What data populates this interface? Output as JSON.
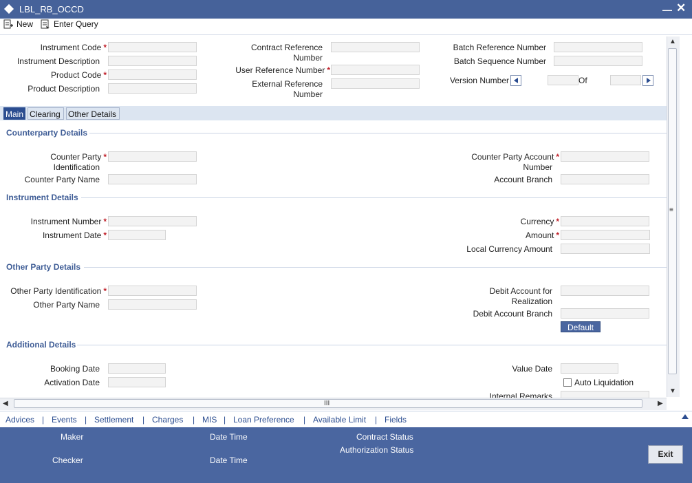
{
  "window": {
    "title": "LBL_RB_OCCD"
  },
  "toolbar": {
    "new_label": "New",
    "enter_query_label": "Enter Query"
  },
  "header": {
    "instrument_code": "Instrument Code",
    "instrument_description": "Instrument Description",
    "product_code": "Product Code",
    "product_description": "Product Description",
    "contract_reference_1": "Contract Reference",
    "contract_reference_2": "Number",
    "user_reference_number": "User Reference Number",
    "external_reference_1": "External Reference",
    "external_reference_2": "Number",
    "batch_reference_number": "Batch Reference Number",
    "batch_sequence_number": "Batch Sequence Number",
    "version_number": "Version Number",
    "of": "Of"
  },
  "required_marker": "*",
  "tabs": {
    "main": "Main",
    "clearing": "Clearing",
    "other_details": "Other Details"
  },
  "sections": {
    "counterparty": "Counterparty Details",
    "instrument": "Instrument Details",
    "other_party": "Other Party Details",
    "additional": "Additional Details"
  },
  "counterparty": {
    "identification_1": "Counter Party",
    "identification_2": "Identification",
    "name": "Counter Party Name",
    "account_1": "Counter Party Account",
    "account_2": "Number",
    "account_branch": "Account Branch"
  },
  "instrument": {
    "number": "Instrument Number",
    "date": "Instrument Date",
    "currency": "Currency",
    "amount": "Amount",
    "local_currency_amount": "Local Currency Amount"
  },
  "other_party": {
    "identification": "Other Party Identification",
    "name": "Other Party Name",
    "debit_account_1": "Debit Account for",
    "debit_account_2": "Realization",
    "debit_account_branch": "Debit Account Branch",
    "default_button": "Default"
  },
  "additional": {
    "booking_date": "Booking Date",
    "activation_date": "Activation Date",
    "value_date": "Value Date",
    "auto_liquidation": "Auto Liquidation",
    "internal_remarks": "Internal Remarks"
  },
  "scrollbar": {
    "h_grip": "III",
    "v_grip": "≡"
  },
  "links": [
    "Advices",
    "Events",
    "Settlement",
    "Charges",
    "MIS",
    "Loan Preference",
    "Available Limit",
    "Fields"
  ],
  "link_separator": "|",
  "footer": {
    "maker": "Maker",
    "checker": "Checker",
    "date_time": "Date Time",
    "contract_status": "Contract Status",
    "authorization_status": "Authorization Status",
    "exit_button": "Exit"
  },
  "colors": {
    "title_bar": "#46629a",
    "footer": "#4a66a0",
    "active_tab": "#2b4d90",
    "required": "#c0202a",
    "section_heading": "#3f5d96"
  }
}
